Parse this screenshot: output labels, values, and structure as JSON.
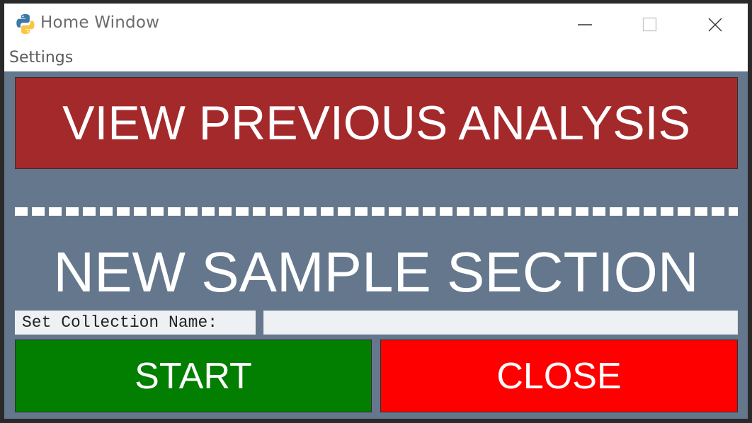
{
  "window": {
    "title": "Home Window",
    "icon": "python-logo-icon",
    "controls": [
      "minimize-icon",
      "maximize-icon",
      "close-icon"
    ]
  },
  "menu": {
    "items": [
      "Settings"
    ]
  },
  "main": {
    "view_previous_label": "VIEW PREVIOUS ANALYSIS",
    "section_heading": "NEW SAMPLE SECTION",
    "collection_label": "Set Collection Name:",
    "collection_value": "",
    "start_label": "START",
    "close_label": "CLOSE"
  },
  "colors": {
    "background": "#64778d",
    "view_button": "#a4292b",
    "start_button": "#027e00",
    "close_button": "#ff0000",
    "input_background": "#eef1f4"
  }
}
